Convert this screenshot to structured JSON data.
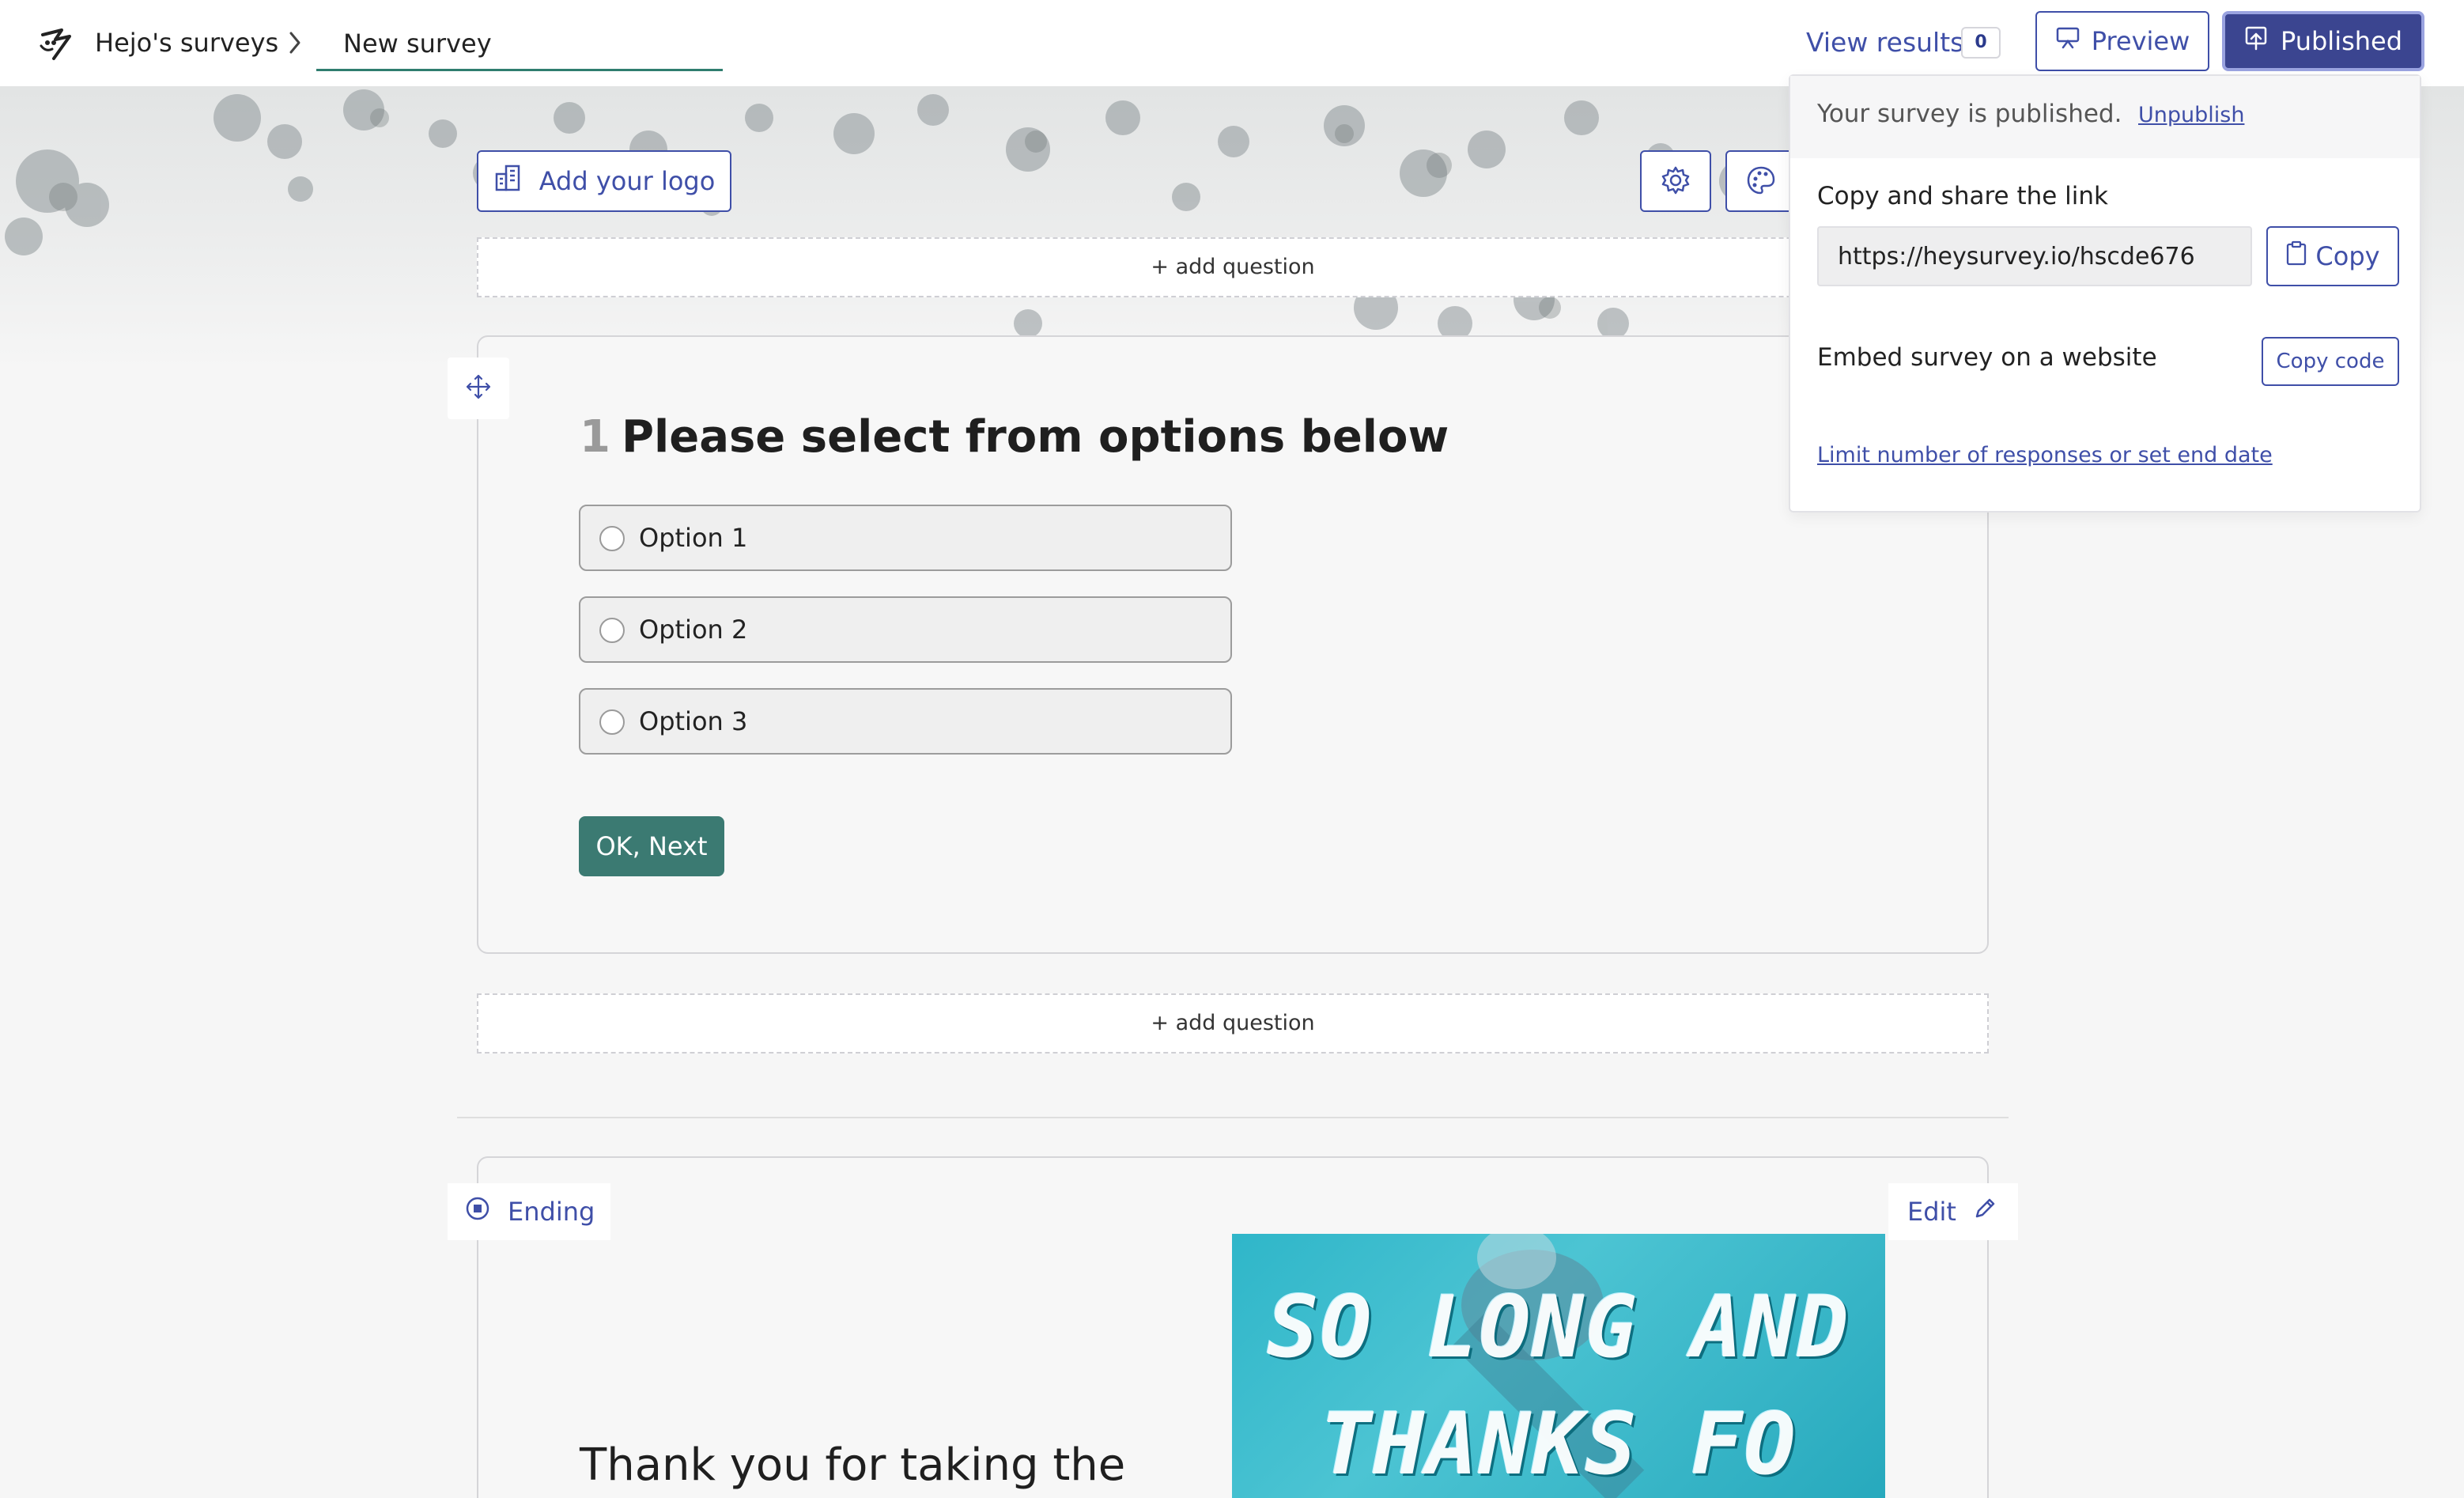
{
  "header": {
    "breadcrumb_root": "Hejo's surveys",
    "survey_title": "New survey",
    "view_results_label": "View results",
    "results_count": "0",
    "preview_label": "Preview",
    "published_label": "Published"
  },
  "toolbar": {
    "add_logo_label": "Add your logo"
  },
  "add_question_label": "+ add question",
  "question": {
    "number": "1",
    "title": "Please select from options below",
    "options": [
      {
        "label": "Option 1"
      },
      {
        "label": "Option 2"
      },
      {
        "label": "Option 3"
      }
    ],
    "next_button_label": "OK, Next"
  },
  "ending": {
    "tag_label": "Ending",
    "edit_label": "Edit",
    "text": "Thank you for taking the",
    "image_text_line1": "SO LONG AND",
    "image_text_line2": "THANKS FO"
  },
  "publish_panel": {
    "status_text": "Your survey is published.",
    "unpublish_label": "Unpublish",
    "share_title": "Copy and share the link",
    "share_link": "https://heysurvey.io/hscde676",
    "copy_label": "Copy",
    "embed_title": "Embed survey on a website",
    "copy_code_label": "Copy code",
    "limit_link": "Limit number of responses or set end date"
  },
  "colors": {
    "accent": "#3f4fa8",
    "published_bg": "#3b4590",
    "next_button": "#3b7a72",
    "underline": "#2f7d6f"
  },
  "icons": {
    "logo": "hejo-logo-icon",
    "breadcrumb_separator": "chevron-right-icon",
    "preview": "presentation-icon",
    "published": "upload-icon",
    "add_logo": "building-icon",
    "settings": "gear-icon",
    "theme": "palette-icon",
    "drag": "move-arrows-icon",
    "ending": "radio-dot-icon",
    "edit": "pencil-icon",
    "copy": "clipboard-icon"
  }
}
